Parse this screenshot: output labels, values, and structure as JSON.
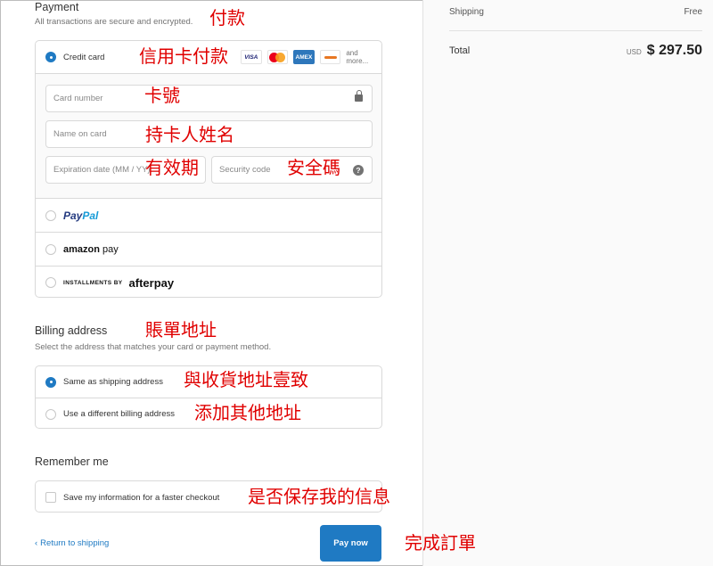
{
  "payment": {
    "title": "Payment",
    "subtitle": "All transactions are secure and encrypted.",
    "options": {
      "credit_card": "Credit card",
      "paypal_1": "Pay",
      "paypal_2": "Pal",
      "amazon_1": "amazon",
      "amazon_2": " pay",
      "afterpay_small": "INSTALLMENTS BY",
      "afterpay_logo": "afterpay"
    },
    "brands": {
      "visa": "VISA",
      "amex": "AMEX",
      "discover": "",
      "more": "and more..."
    },
    "fields": {
      "card_number": "Card number",
      "name_on_card": "Name on card",
      "expiration": "Expiration date (MM / YY)",
      "security_code": "Security code",
      "help_glyph": "?"
    }
  },
  "billing": {
    "title": "Billing address",
    "subtitle": "Select the address that matches your card or payment method.",
    "same_label": "Same as shipping address",
    "different_label": "Use a different billing address"
  },
  "remember": {
    "title": "Remember me",
    "save_label": "Save my information for a faster checkout"
  },
  "footer": {
    "back_label": "Return to shipping",
    "back_glyph": "‹",
    "pay_label": "Pay now"
  },
  "summary": {
    "shipping_label": "Shipping",
    "shipping_value": "Free",
    "total_label": "Total",
    "currency": "USD",
    "total_value": "$ 297.50"
  },
  "annotations": {
    "payment": "付款",
    "credit_card": "信用卡付款",
    "card_number": "卡號",
    "cardholder": "持卡人姓名",
    "expiry": "有效期",
    "security": "安全碼",
    "billing": "賬單地址",
    "same_as_shipping": "與收貨地址壹致",
    "add_other": "添加其他地址",
    "save_info": "是否保存我的信息",
    "complete_order": "完成訂單"
  },
  "colors": {
    "accent": "#1f7ac3",
    "annotation": "#e00000",
    "paypal_dark": "#253b80",
    "paypal_light": "#179bd7"
  },
  "icons": [
    "lock-icon",
    "help-icon",
    "chevron-left-icon",
    "visa-icon",
    "mastercard-icon",
    "amex-icon",
    "discover-icon"
  ]
}
